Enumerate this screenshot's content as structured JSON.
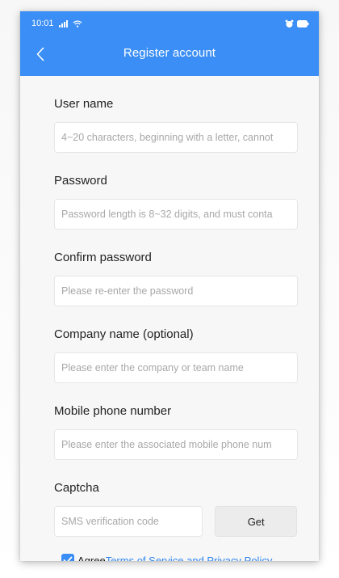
{
  "status_bar": {
    "time": "10:01",
    "icons": [
      "signal-icon",
      "wifi-icon",
      "alarm-icon",
      "battery-icon"
    ]
  },
  "header": {
    "title": "Register account",
    "back_icon": "chevron-left-icon"
  },
  "colors": {
    "accent": "#3a8ef6",
    "link": "#2f86f0"
  },
  "form": {
    "username": {
      "label": "User name",
      "placeholder": "4~20 characters, beginning with a letter, cannot",
      "value": ""
    },
    "password": {
      "label": "Password",
      "placeholder": "Password length is 8~32 digits, and must conta",
      "value": ""
    },
    "confirm_password": {
      "label": "Confirm password",
      "placeholder": "Please re-enter the password",
      "value": ""
    },
    "company": {
      "label": "Company name (optional)",
      "placeholder": "Please enter the company or team name",
      "value": ""
    },
    "mobile": {
      "label": "Mobile phone number",
      "placeholder": "Please enter the associated mobile phone num",
      "value": ""
    },
    "captcha": {
      "label": "Captcha",
      "placeholder": "SMS verification code",
      "value": "",
      "button_label": "Get"
    }
  },
  "agreement": {
    "checked": true,
    "prefix": "Agree",
    "link_text": "Terms of Service and Privacy Policy"
  }
}
